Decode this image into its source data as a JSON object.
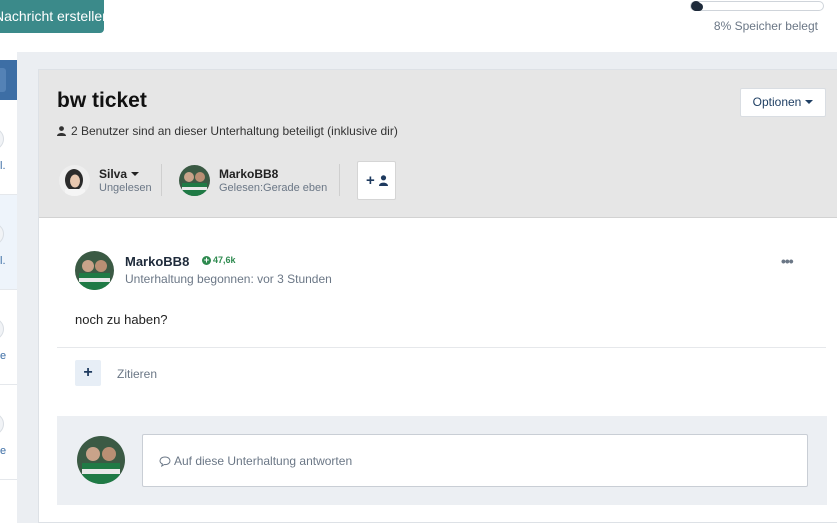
{
  "topbar": {
    "new_message_label": "Nachricht erstellen",
    "storage_text": "8% Speicher belegt",
    "storage_percent": 8
  },
  "sidebar": {
    "items": [
      {
        "label": "l."
      },
      {
        "label": "l."
      },
      {
        "label": "e"
      },
      {
        "label": "e"
      }
    ]
  },
  "conversation": {
    "title": "bw ticket",
    "participants_text": "2 Benutzer sind an dieser Unterhaltung beteiligt (inklusive dir)",
    "options_label": "Optionen",
    "members": [
      {
        "name": "Silva",
        "status": "Ungelesen"
      },
      {
        "name": "MarkoBB8",
        "status": "Gelesen:Gerade eben"
      }
    ],
    "add_member_symbol": "+"
  },
  "message": {
    "author": "MarkoBB8",
    "reputation": "47,6k",
    "meta": "Unterhaltung begonnen: vor 3 Stunden",
    "body": "noch zu haben?",
    "more_symbol": "•••",
    "plus_symbol": "+",
    "quote_label": "Zitieren"
  },
  "reply": {
    "placeholder": "Auf diese Unterhaltung antworten"
  },
  "colors": {
    "accent": "#3b8a8a",
    "nav_blue": "#3d6ea5",
    "reputation_green": "#2e8a4f",
    "header_bg": "#e6e6e6"
  }
}
